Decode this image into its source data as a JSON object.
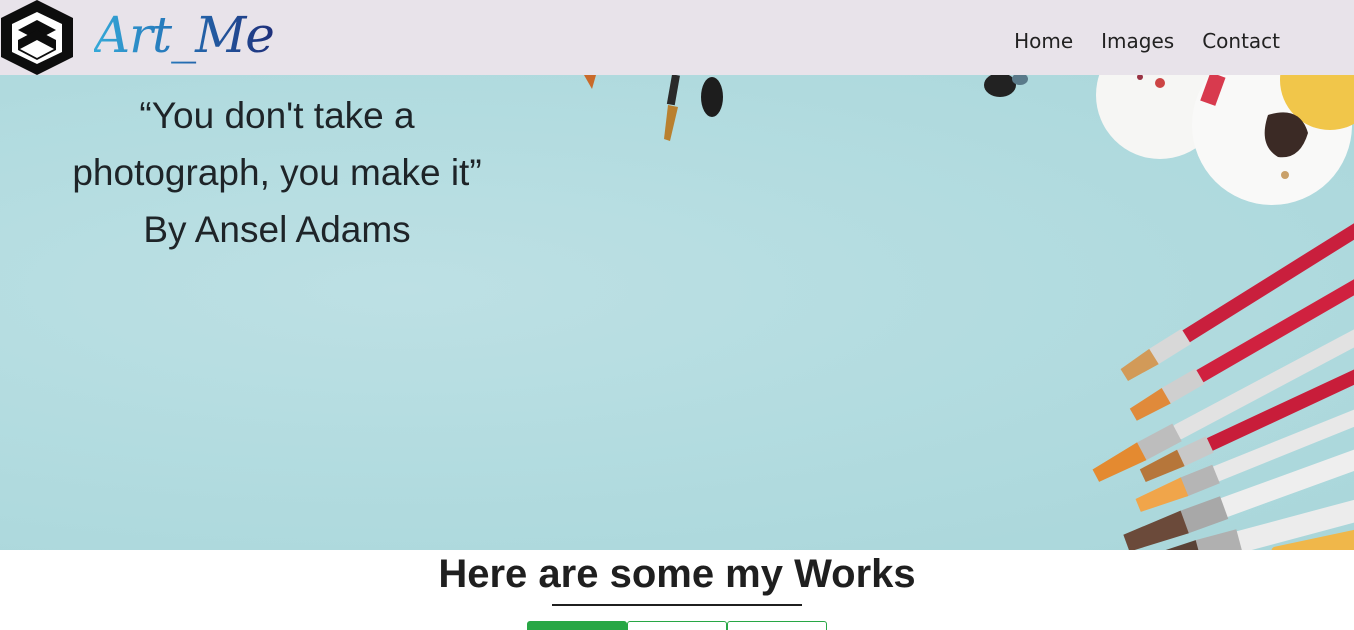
{
  "nav": {
    "brand": "Art_Me",
    "links": [
      {
        "label": "Home"
      },
      {
        "label": "Images"
      },
      {
        "label": "Contact"
      }
    ]
  },
  "hero": {
    "quote_line1": "“You don't take a",
    "quote_line2": "photograph, you make it”",
    "quote_author": "By Ansel Adams"
  },
  "works": {
    "title": "Here are some my Works",
    "filters": [
      {
        "label": "",
        "active": true
      },
      {
        "label": "",
        "active": false
      },
      {
        "label": "",
        "active": false
      }
    ]
  },
  "colors": {
    "navbar_bg": "#e8e3ea",
    "hero_bg": "#b3dce0",
    "accent_green": "#28a745"
  }
}
